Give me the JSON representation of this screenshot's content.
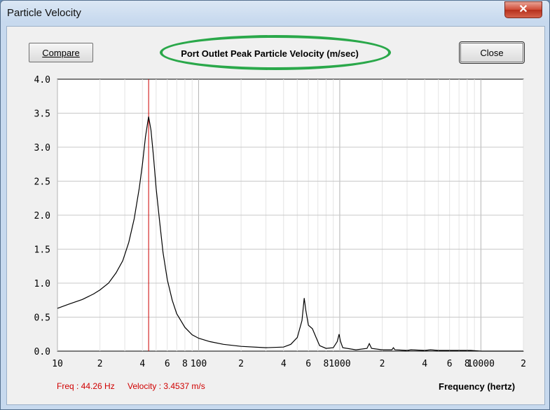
{
  "window": {
    "title": "Particle Velocity",
    "close_glyph": "✕"
  },
  "toolbar": {
    "compare_label": "Compare",
    "close_label": "Close"
  },
  "readout": {
    "freq": "Freq : 44.26 Hz",
    "velocity": "Velocity : 3.4537 m/s"
  },
  "colors": {
    "marker": "#cc0000",
    "highlight": "#2aa84a",
    "curve": "#000000",
    "grid": "#c8c8c8"
  },
  "chart_data": {
    "type": "line",
    "title": "Port Outlet Peak Particle Velocity (m/sec)",
    "xlabel": "Frequency (hertz)",
    "ylabel": "",
    "xscale": "log",
    "xlim": [
      10,
      20000
    ],
    "ylim": [
      0,
      4
    ],
    "yticks": [
      "0.0",
      "0.5",
      "1.0",
      "1.5",
      "2.0",
      "2.5",
      "3.0",
      "3.5",
      "4.0"
    ],
    "xticks": [
      {
        "v": 10,
        "label": "10"
      },
      {
        "v": 20,
        "label": "2"
      },
      {
        "v": 40,
        "label": "4"
      },
      {
        "v": 60,
        "label": "6"
      },
      {
        "v": 80,
        "label": "8"
      },
      {
        "v": 100,
        "label": "100"
      },
      {
        "v": 200,
        "label": "2"
      },
      {
        "v": 400,
        "label": "4"
      },
      {
        "v": 600,
        "label": "6"
      },
      {
        "v": 800,
        "label": "8"
      },
      {
        "v": 1000,
        "label": "1000"
      },
      {
        "v": 2000,
        "label": "2"
      },
      {
        "v": 4000,
        "label": "4"
      },
      {
        "v": 6000,
        "label": "6"
      },
      {
        "v": 8000,
        "label": "8"
      },
      {
        "v": 10000,
        "label": "10000"
      },
      {
        "v": 20000,
        "label": "2"
      }
    ],
    "marker_freq": 44.26,
    "grid": true,
    "series": [
      {
        "points": [
          [
            10,
            0.63
          ],
          [
            12,
            0.69
          ],
          [
            15,
            0.76
          ],
          [
            18,
            0.84
          ],
          [
            20,
            0.9
          ],
          [
            23,
            1.0
          ],
          [
            26,
            1.15
          ],
          [
            29,
            1.33
          ],
          [
            32,
            1.6
          ],
          [
            35,
            1.95
          ],
          [
            38,
            2.4
          ],
          [
            40,
            2.75
          ],
          [
            42,
            3.15
          ],
          [
            44.26,
            3.45
          ],
          [
            46,
            3.25
          ],
          [
            48,
            2.85
          ],
          [
            50,
            2.4
          ],
          [
            53,
            1.9
          ],
          [
            56,
            1.45
          ],
          [
            60,
            1.05
          ],
          [
            65,
            0.75
          ],
          [
            70,
            0.55
          ],
          [
            80,
            0.35
          ],
          [
            90,
            0.24
          ],
          [
            100,
            0.19
          ],
          [
            120,
            0.14
          ],
          [
            150,
            0.1
          ],
          [
            200,
            0.07
          ],
          [
            300,
            0.05
          ],
          [
            400,
            0.06
          ],
          [
            450,
            0.1
          ],
          [
            500,
            0.2
          ],
          [
            540,
            0.45
          ],
          [
            560,
            0.78
          ],
          [
            575,
            0.6
          ],
          [
            600,
            0.38
          ],
          [
            640,
            0.33
          ],
          [
            680,
            0.2
          ],
          [
            720,
            0.08
          ],
          [
            800,
            0.04
          ],
          [
            900,
            0.05
          ],
          [
            960,
            0.14
          ],
          [
            990,
            0.25
          ],
          [
            1010,
            0.15
          ],
          [
            1050,
            0.05
          ],
          [
            1300,
            0.02
          ],
          [
            1560,
            0.04
          ],
          [
            1620,
            0.11
          ],
          [
            1680,
            0.04
          ],
          [
            2000,
            0.02
          ],
          [
            2340,
            0.02
          ],
          [
            2400,
            0.05
          ],
          [
            2460,
            0.02
          ],
          [
            3000,
            0.01
          ],
          [
            3200,
            0.02
          ],
          [
            4000,
            0.01
          ],
          [
            4400,
            0.02
          ],
          [
            5000,
            0.01
          ],
          [
            6000,
            0.01
          ],
          [
            7000,
            0.01
          ],
          [
            8500,
            0.01
          ],
          [
            10000,
            0.0
          ],
          [
            20000,
            0.0
          ]
        ]
      }
    ]
  }
}
